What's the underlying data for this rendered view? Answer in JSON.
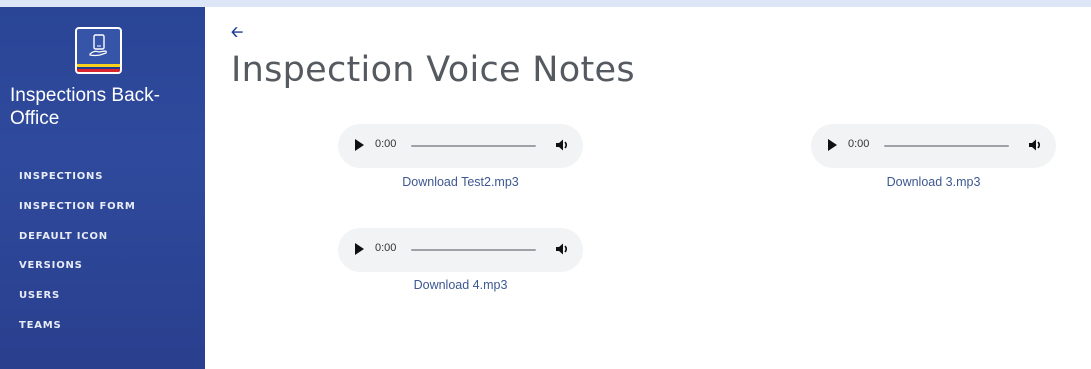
{
  "app": {
    "title": "Inspections Back-Office"
  },
  "sidebar": {
    "items": [
      {
        "label": "INSPECTIONS"
      },
      {
        "label": "INSPECTION FORM"
      },
      {
        "label": "DEFAULT ICON"
      },
      {
        "label": "VERSIONS"
      },
      {
        "label": "USERS"
      },
      {
        "label": "TEAMS"
      }
    ]
  },
  "header": {
    "back_icon": "arrow-left-icon",
    "title": "Inspection Voice Notes"
  },
  "voice_notes": [
    {
      "time": "0:00",
      "link": "Download Test2.mp3"
    },
    {
      "time": "0:00",
      "link": "Download 3.mp3"
    },
    {
      "time": "0:00",
      "link": "Download 4.mp3"
    }
  ],
  "colors": {
    "sidebar": "#2f4a9c",
    "accent": "#1f3a93",
    "link": "#3d5890",
    "player_bg": "#f1f3f4"
  }
}
